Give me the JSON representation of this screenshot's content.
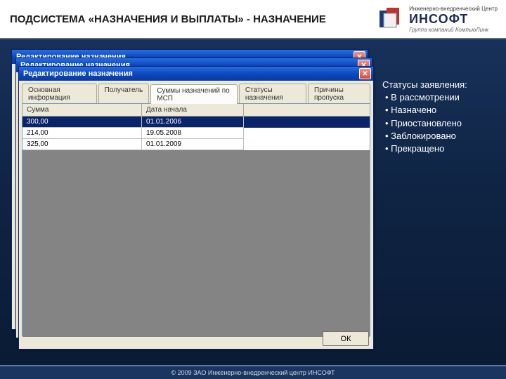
{
  "header": {
    "title": "ПОДСИСТЕМА «НАЗНАЧЕНИЯ И ВЫПЛАТЫ» - НАЗНАЧЕНИЕ",
    "logo_line1": "Инженерно-внедренческий Центр",
    "logo_line2": "ИНСОФТ",
    "logo_line3": "Группа компаний КомпьюЛинк"
  },
  "windows": {
    "title": "Редактирование назначения",
    "close_glyph": "✕",
    "tabs": [
      {
        "label": "Основная информация"
      },
      {
        "label": "Получатель"
      },
      {
        "label": "Суммы назначений по МСП"
      },
      {
        "label": "Статусы назначения"
      },
      {
        "label": "Причины пропуска"
      }
    ],
    "grid": {
      "columns": [
        "Сумма",
        "Дата начала"
      ],
      "rows": [
        {
          "sum": "300,00",
          "date": "01.01.2006"
        },
        {
          "sum": "214,00",
          "date": "19.05.2008"
        },
        {
          "sum": "325,00",
          "date": "01.01.2009"
        }
      ]
    },
    "ok_label": "ОК"
  },
  "side": {
    "heading": "Статусы заявления:",
    "items": [
      "В рассмотрении",
      "Назначено",
      "Приостановлено",
      "Заблокировано",
      "Прекращено"
    ]
  },
  "footer": "© 2009 ЗАО Инженерно-внедренческий центр ИНСОФТ"
}
